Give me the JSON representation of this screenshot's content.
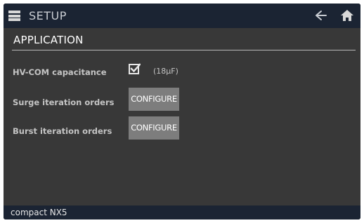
{
  "header": {
    "title": "SETUP",
    "menu_icon": "menu-icon",
    "back_icon": "arrow-left-icon",
    "home_icon": "home-icon"
  },
  "section": {
    "title": "APPLICATION"
  },
  "rows": [
    {
      "label": "HV-COM capacitance",
      "checkbox_checked": true,
      "value": "(18µF)"
    },
    {
      "label": "Surge iteration orders",
      "button_label": "CONFIGURE"
    },
    {
      "label": "Burst iteration orders",
      "button_label": "CONFIGURE"
    }
  ],
  "footer": {
    "device_name": "compact NX5"
  },
  "colors": {
    "bar_background": "#1b2433",
    "panel_background": "#383838",
    "button_background": "#7d7d7d",
    "label_text": "#c4c4c4"
  }
}
